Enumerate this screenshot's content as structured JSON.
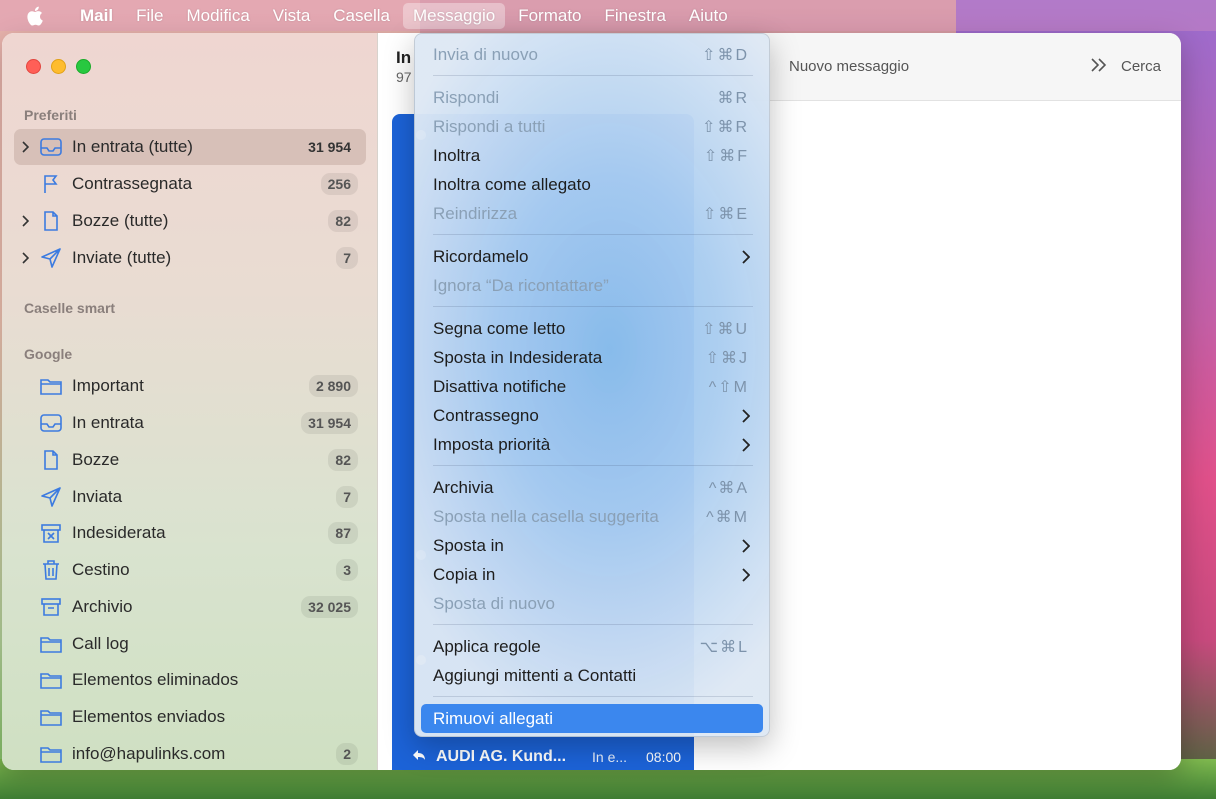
{
  "menubar": {
    "app": "Mail",
    "items": [
      "File",
      "Modifica",
      "Vista",
      "Casella",
      "Messaggio",
      "Formato",
      "Finestra",
      "Aiuto"
    ],
    "active": "Messaggio"
  },
  "sidebar": {
    "favorites_title": "Preferiti",
    "favorites": [
      {
        "label": "In entrata (tutte)",
        "count": "31 954",
        "icon": "inbox-icon",
        "expandable": true,
        "selected": true
      },
      {
        "label": "Contrassegnata",
        "count": "256",
        "icon": "flag-icon",
        "expandable": false
      },
      {
        "label": "Bozze (tutte)",
        "count": "82",
        "icon": "document-icon",
        "expandable": true
      },
      {
        "label": "Inviate (tutte)",
        "count": "7",
        "icon": "paperplane-icon",
        "expandable": true
      }
    ],
    "smart_title": "Caselle smart",
    "google_title": "Google",
    "google": [
      {
        "label": "Important",
        "count": "2 890",
        "icon": "folder-icon"
      },
      {
        "label": "In entrata",
        "count": "31 954",
        "icon": "inbox-icon"
      },
      {
        "label": "Bozze",
        "count": "82",
        "icon": "document-icon"
      },
      {
        "label": "Inviata",
        "count": "7",
        "icon": "paperplane-icon"
      },
      {
        "label": "Indesiderata",
        "count": "87",
        "icon": "junk-icon"
      },
      {
        "label": "Cestino",
        "count": "3",
        "icon": "trash-icon"
      },
      {
        "label": "Archivio",
        "count": "32 025",
        "icon": "archive-icon"
      },
      {
        "label": "Call log",
        "count": "",
        "icon": "folder-icon"
      },
      {
        "label": "Elementos eliminados",
        "count": "",
        "icon": "folder-icon"
      },
      {
        "label": "Elementos enviados",
        "count": "",
        "icon": "folder-icon"
      },
      {
        "label": "info@hapulinks.com",
        "count": "2",
        "icon": "folder-icon"
      }
    ]
  },
  "list": {
    "title": "In",
    "subtitle": "97",
    "last_message": {
      "sender": "AUDI AG. Kund...",
      "mailbox": "In e...",
      "time": "08:00"
    }
  },
  "toolbar": {
    "new_message": "Nuovo messaggio",
    "search": "Cerca"
  },
  "menu": {
    "items": [
      {
        "label": "Invia di nuovo",
        "shortcut": "⇧⌘D",
        "disabled": true
      },
      {
        "sep": true
      },
      {
        "label": "Rispondi",
        "shortcut": "⌘R",
        "disabled": true
      },
      {
        "label": "Rispondi a tutti",
        "shortcut": "⇧⌘R",
        "disabled": true
      },
      {
        "label": "Inoltra",
        "shortcut": "⇧⌘F",
        "disabled": false
      },
      {
        "label": "Inoltra come allegato",
        "shortcut": "",
        "disabled": false
      },
      {
        "label": "Reindirizza",
        "shortcut": "⇧⌘E",
        "disabled": true
      },
      {
        "sep": true
      },
      {
        "label": "Ricordamelo",
        "shortcut": "",
        "disabled": false,
        "submenu": true
      },
      {
        "label": "Ignora “Da ricontattare”",
        "shortcut": "",
        "disabled": true
      },
      {
        "sep": true
      },
      {
        "label": "Segna come letto",
        "shortcut": "⇧⌘U",
        "disabled": false
      },
      {
        "label": "Sposta in Indesiderata",
        "shortcut": "⇧⌘J",
        "disabled": false
      },
      {
        "label": "Disattiva notifiche",
        "shortcut": "^⇧M",
        "disabled": false
      },
      {
        "label": "Contrassegno",
        "shortcut": "",
        "disabled": false,
        "submenu": true
      },
      {
        "label": "Imposta priorità",
        "shortcut": "",
        "disabled": false,
        "submenu": true
      },
      {
        "sep": true
      },
      {
        "label": "Archivia",
        "shortcut": "^⌘A",
        "disabled": false
      },
      {
        "label": "Sposta nella casella suggerita",
        "shortcut": "^⌘M",
        "disabled": true
      },
      {
        "label": "Sposta in",
        "shortcut": "",
        "disabled": false,
        "submenu": true
      },
      {
        "label": "Copia in",
        "shortcut": "",
        "disabled": false,
        "submenu": true
      },
      {
        "label": "Sposta di nuovo",
        "shortcut": "",
        "disabled": true
      },
      {
        "sep": true
      },
      {
        "label": "Applica regole",
        "shortcut": "⌥⌘L",
        "disabled": false
      },
      {
        "label": "Aggiungi mittenti a Contatti",
        "shortcut": "",
        "disabled": false
      },
      {
        "sep": true
      },
      {
        "label": "Rimuovi allegati",
        "shortcut": "",
        "disabled": false,
        "highlight": true
      }
    ]
  }
}
